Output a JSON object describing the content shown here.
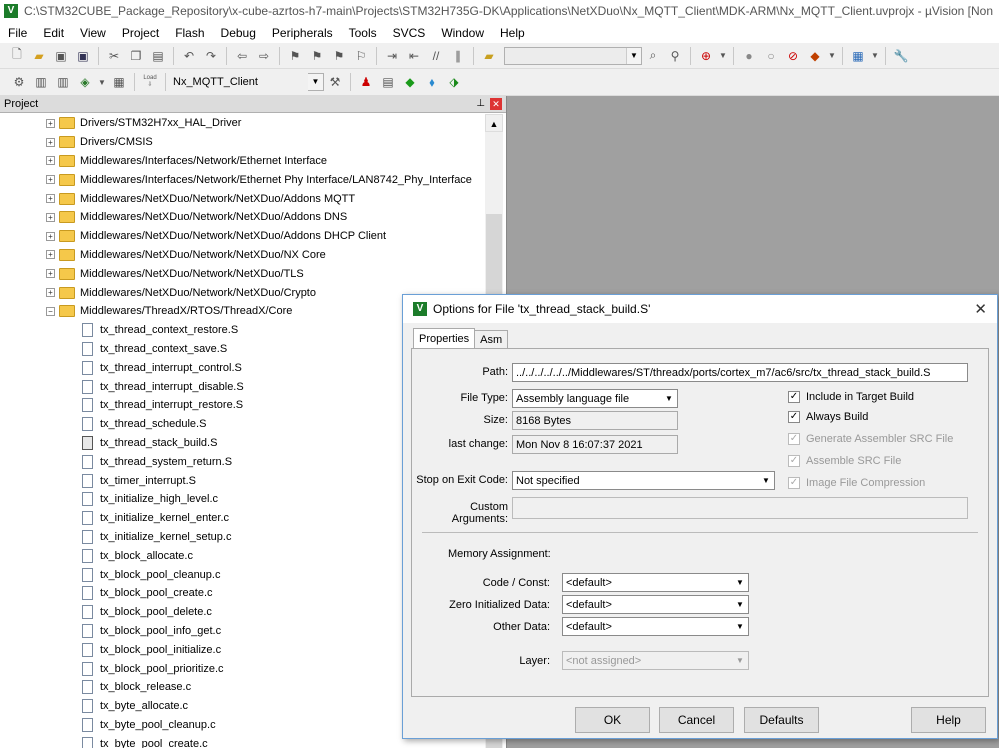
{
  "window": {
    "title": "C:\\STM32CUBE_Package_Repository\\x-cube-azrtos-h7-main\\Projects\\STM32H735G-DK\\Applications\\NetXDuo\\Nx_MQTT_Client\\MDK-ARM\\Nx_MQTT_Client.uvprojx - µVision  [Non"
  },
  "menu": [
    "File",
    "Edit",
    "View",
    "Project",
    "Flash",
    "Debug",
    "Peripherals",
    "Tools",
    "SVCS",
    "Window",
    "Help"
  ],
  "toolbar": {
    "target_select": "Nx_MQTT_Client",
    "load_label": "Load"
  },
  "project_panel": {
    "title": "Project",
    "folders": [
      "Drivers/STM32H7xx_HAL_Driver",
      "Drivers/CMSIS",
      "Middlewares/Interfaces/Network/Ethernet Interface",
      "Middlewares/Interfaces/Network/Ethernet Phy Interface/LAN8742_Phy_Interface",
      "Middlewares/NetXDuo/Network/NetXDuo/Addons MQTT",
      "Middlewares/NetXDuo/Network/NetXDuo/Addons DNS",
      "Middlewares/NetXDuo/Network/NetXDuo/Addons DHCP Client",
      "Middlewares/NetXDuo/Network/NetXDuo/NX Core",
      "Middlewares/NetXDuo/Network/NetXDuo/TLS",
      "Middlewares/NetXDuo/Network/NetXDuo/Crypto"
    ],
    "expanded_folder": "Middlewares/ThreadX/RTOS/ThreadX/Core",
    "files": [
      "tx_thread_context_restore.S",
      "tx_thread_context_save.S",
      "tx_thread_interrupt_control.S",
      "tx_thread_interrupt_disable.S",
      "tx_thread_interrupt_restore.S",
      "tx_thread_schedule.S",
      "tx_thread_stack_build.S",
      "tx_thread_system_return.S",
      "tx_timer_interrupt.S",
      "tx_initialize_high_level.c",
      "tx_initialize_kernel_enter.c",
      "tx_initialize_kernel_setup.c",
      "tx_block_allocate.c",
      "tx_block_pool_cleanup.c",
      "tx_block_pool_create.c",
      "tx_block_pool_delete.c",
      "tx_block_pool_info_get.c",
      "tx_block_pool_initialize.c",
      "tx_block_pool_prioritize.c",
      "tx_block_release.c",
      "tx_byte_allocate.c",
      "tx_byte_pool_cleanup.c",
      "tx_byte_pool_create.c"
    ]
  },
  "dialog": {
    "title": "Options for File 'tx_thread_stack_build.S'",
    "tabs": [
      "Properties",
      "Asm"
    ],
    "path_label": "Path:",
    "path_value": "../../../../../../Middlewares/ST/threadx/ports/cortex_m7/ac6/src/tx_thread_stack_build.S",
    "file_type_label": "File Type:",
    "file_type_value": "Assembly language file",
    "size_label": "Size:",
    "size_value": "8168 Bytes",
    "last_change_label": "last change:",
    "last_change_value": "Mon Nov  8 16:07:37 2021",
    "stop_on_exit_label": "Stop on Exit Code:",
    "stop_on_exit_value": "Not specified",
    "custom_args_label": "Custom Arguments:",
    "custom_args_value": "",
    "checkboxes": [
      {
        "label": "Include in Target Build",
        "checked": true,
        "enabled": true
      },
      {
        "label": "Always Build",
        "checked": true,
        "enabled": true
      },
      {
        "label": "Generate Assembler SRC File",
        "checked": true,
        "enabled": false
      },
      {
        "label": "Assemble SRC File",
        "checked": true,
        "enabled": false
      },
      {
        "label": "Image File Compression",
        "checked": true,
        "enabled": false
      }
    ],
    "memory_title": "Memory Assignment:",
    "code_const_label": "Code / Const:",
    "code_const_value": "<default>",
    "zero_init_label": "Zero Initialized Data:",
    "zero_init_value": "<default>",
    "other_data_label": "Other Data:",
    "other_data_value": "<default>",
    "layer_label": "Layer:",
    "layer_value": "<not assigned>",
    "buttons": {
      "ok": "OK",
      "cancel": "Cancel",
      "defaults": "Defaults",
      "help": "Help"
    }
  }
}
